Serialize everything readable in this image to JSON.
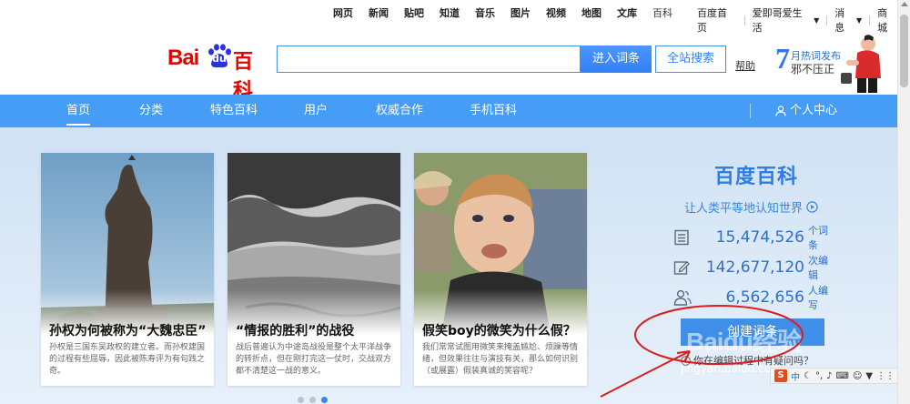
{
  "topbar": {
    "nav": [
      "网页",
      "新闻",
      "贴吧",
      "知道",
      "音乐",
      "图片",
      "视频",
      "地图",
      "文库",
      "百科"
    ],
    "current": "百科",
    "links": [
      "百度首页",
      "爱即哥爱生活",
      "消息",
      "商城"
    ]
  },
  "header": {
    "logo_bai": "Bai",
    "logo_du": "du",
    "logo_baike": "百科",
    "search_value": "",
    "search_button": "进入词条",
    "site_search_button": "全站搜索",
    "help": "帮助",
    "hot_num": "7",
    "hot_line1": "月热词发布",
    "hot_line2": "邪不压正"
  },
  "mainnav": {
    "items": [
      "首页",
      "分类",
      "特色百科",
      "用户",
      "权威合作",
      "手机百科"
    ],
    "active": "首页",
    "user_center": "个人中心"
  },
  "cards": [
    {
      "title": "孙权为何被称为“大魏忠臣”",
      "desc": "孙权是三国东吴政权的建立者。而孙权建国的过程有些屈辱，因此被陈寿评为有句践之奇。"
    },
    {
      "title": "“情报的胜利”的战役",
      "desc": "战后普遍认为中途岛战役是整个太平洋战争的转折点，但在刚打完这一仗时，交战双方都不清楚这一战的意义。"
    },
    {
      "title": "假笑boy的微笑为什么假？",
      "desc": "我们常常试图用微笑来掩盖尴尬、烦躁等情绪，但效果往往与演技有关，那么如何识别（或展露）假装真诚的笑容呢？"
    }
  ],
  "slider": {
    "page_count": 3,
    "active_index": 2
  },
  "panel": {
    "title": "百度百科",
    "slogan": "让人类平等地认知世界",
    "stats": [
      {
        "icon": "document-icon",
        "value": "15,474,526",
        "unit": "个词条"
      },
      {
        "icon": "edit-icon",
        "value": "142,677,120",
        "unit": "次编辑"
      },
      {
        "icon": "users-icon",
        "value": "6,562,656",
        "unit": "人编写"
      }
    ],
    "create_button": "创建词条",
    "faq": "你在编辑过程中有疑问吗？"
  },
  "watermark": {
    "brand": "Baidu经验",
    "url": "jingyan.baidu.com"
  },
  "colors": {
    "nav_blue": "#459df5",
    "brand_red": "#e10602",
    "link_blue": "#2f7de0",
    "annotation_red": "#d81e1e"
  }
}
